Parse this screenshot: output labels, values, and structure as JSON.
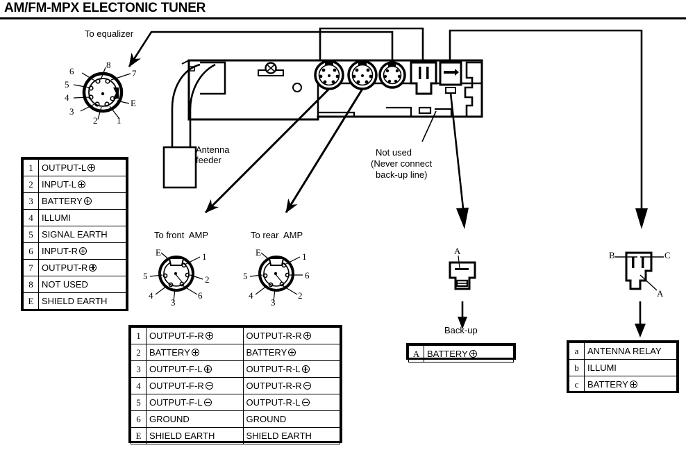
{
  "title": "AM/FM-MPX ELECTONIC TUNER",
  "labels": {
    "to_equalizer": "To equalizer",
    "antenna_feeder_l1": "Antenna",
    "antenna_feeder_l2": "feeder",
    "not_used_l1": "Not used",
    "not_used_l2": "(Never connect",
    "not_used_l3": "back-up line)",
    "to_front_amp": "To front  AMP",
    "to_rear_amp": "To rear  AMP",
    "back_up": "Back-up"
  },
  "equalizer_connector": {
    "name": "8-pin DIN equalizer connector",
    "pins": [
      "6",
      "5",
      "4",
      "3",
      "2",
      "1",
      "E",
      "7",
      "8"
    ]
  },
  "front_amp_connector": {
    "name": "front amp connector",
    "pins": [
      "E",
      "1",
      "5",
      "2",
      "4",
      "6",
      "3"
    ]
  },
  "rear_amp_connector": {
    "name": "rear amp connector",
    "pins": [
      "E",
      "1",
      "5",
      "6",
      "4",
      "2",
      "3"
    ]
  },
  "backup_connector": {
    "name": "back-up connector",
    "pins": [
      "A"
    ]
  },
  "relay_connector": {
    "name": "antenna relay connector",
    "pins": [
      "B",
      "C",
      "A"
    ]
  },
  "equalizer_table": {
    "name": "equalizer pin assignment table",
    "rows": [
      {
        "pin": "1",
        "text": "OUTPUT-L",
        "sym": "plus"
      },
      {
        "pin": "2",
        "text": "INPUT-L",
        "sym": "plus"
      },
      {
        "pin": "3",
        "text": "BATTERY",
        "sym": "plus"
      },
      {
        "pin": "4",
        "text": "ILLUMI",
        "sym": "none"
      },
      {
        "pin": "5",
        "text": "SIGNAL EARTH",
        "sym": "none"
      },
      {
        "pin": "6",
        "text": "INPUT-R",
        "sym": "plus"
      },
      {
        "pin": "7",
        "text": "OUTPUT-R",
        "sym": "plus"
      },
      {
        "pin": "8",
        "text": "NOT USED",
        "sym": "none"
      },
      {
        "pin": "E",
        "text": "SHIELD EARTH",
        "sym": "none"
      }
    ]
  },
  "amp_table": {
    "name": "front and rear amp pin assignment table",
    "rows": [
      {
        "pin": "1",
        "front": "OUTPUT-F-R",
        "front_sym": "plus",
        "rear": "OUTPUT-R-R",
        "rear_sym": "plus"
      },
      {
        "pin": "2",
        "front": "BATTERY",
        "front_sym": "plus",
        "rear": "BATTERY",
        "rear_sym": "plus"
      },
      {
        "pin": "3",
        "front": "OUTPUT-F-L",
        "front_sym": "plus",
        "rear": "OUTPUT-R-L",
        "rear_sym": "plus"
      },
      {
        "pin": "4",
        "front": "OUTPUT-F-R",
        "front_sym": "minus",
        "rear": "OUTPUT-R-R",
        "rear_sym": "minus"
      },
      {
        "pin": "5",
        "front": "OUTPUT-F-L",
        "front_sym": "minus",
        "rear": "OUTPUT-R-L",
        "rear_sym": "minus"
      },
      {
        "pin": "6",
        "front": "GROUND",
        "front_sym": "none",
        "rear": "GROUND",
        "rear_sym": "none"
      },
      {
        "pin": "E",
        "front": "SHIELD EARTH",
        "front_sym": "none",
        "rear": "SHIELD EARTH",
        "rear_sym": "none"
      }
    ]
  },
  "backup_table": {
    "name": "back-up pin assignment table",
    "rows": [
      {
        "pin": "A",
        "text": "BATTERY",
        "sym": "plus"
      }
    ]
  },
  "relay_table": {
    "name": "antenna relay pin assignment table",
    "rows": [
      {
        "pin": "a",
        "text": "ANTENNA RELAY",
        "sym": "none"
      },
      {
        "pin": "b",
        "text": "ILLUMI",
        "sym": "none"
      },
      {
        "pin": "c",
        "text": "BATTERY",
        "sym": "plus"
      }
    ]
  },
  "colors": {
    "ink": "#000000",
    "paper": "#ffffff"
  }
}
